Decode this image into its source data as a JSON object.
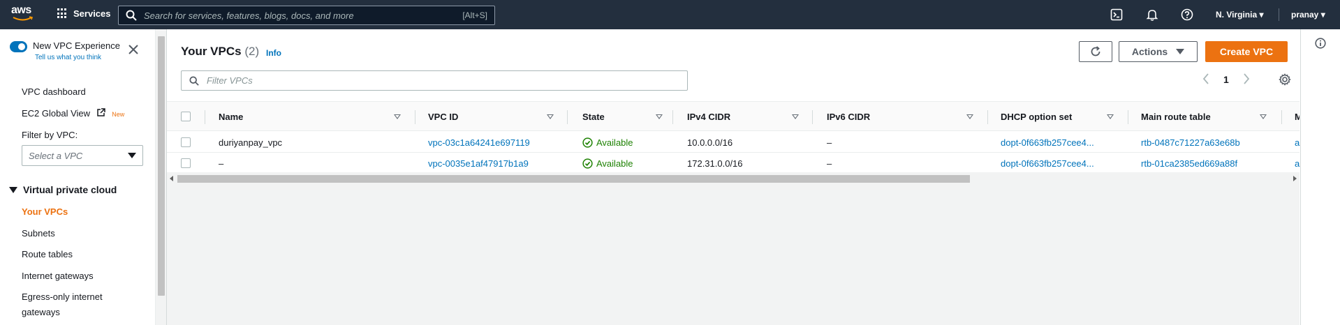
{
  "topnav": {
    "logo_text": "aws",
    "services_label": "Services",
    "search_placeholder": "Search for services, features, blogs, docs, and more",
    "search_shortcut": "[Alt+S]",
    "region": "N. Virginia",
    "user": "pranay"
  },
  "sidebar": {
    "experience_toggle_label": "New VPC Experience",
    "experience_feedback_link": "Tell us what you think",
    "links": {
      "vpc_dashboard": "VPC dashboard",
      "ec2_global_view": "EC2 Global View",
      "new_badge": "New"
    },
    "filter_label": "Filter by VPC:",
    "filter_placeholder": "Select a VPC",
    "section_title": "Virtual private cloud",
    "items": [
      "Your VPCs",
      "Subnets",
      "Route tables",
      "Internet gateways",
      "Egress-only internet",
      "gateways"
    ]
  },
  "main": {
    "title": "Your VPCs",
    "count": "(2)",
    "info_link": "Info",
    "actions_label": "Actions",
    "create_label": "Create VPC",
    "filter_placeholder": "Filter VPCs",
    "page_number": "1",
    "columns": [
      "Name",
      "VPC ID",
      "State",
      "IPv4 CIDR",
      "IPv6 CIDR",
      "DHCP option set",
      "Main route table",
      "M"
    ],
    "rows": [
      {
        "name": "duriyanpay_vpc",
        "vpc_id": "vpc-03c1a64241e697119",
        "state": "Available",
        "ipv4": "10.0.0.0/16",
        "ipv6": "–",
        "dhcp": "dopt-0f663fb257cee4...",
        "route_table": "rtb-0487c71227a63e68b",
        "extra": "a"
      },
      {
        "name": "–",
        "vpc_id": "vpc-0035e1af47917b1a9",
        "state": "Available",
        "ipv4": "172.31.0.0/16",
        "ipv6": "–",
        "dhcp": "dopt-0f663fb257cee4...",
        "route_table": "rtb-01ca2385ed669a88f",
        "extra": "a"
      }
    ]
  },
  "colors": {
    "nav_bg": "#232f3e",
    "accent": "#ec7211",
    "link": "#0073bb",
    "status_ok": "#1d8102"
  }
}
